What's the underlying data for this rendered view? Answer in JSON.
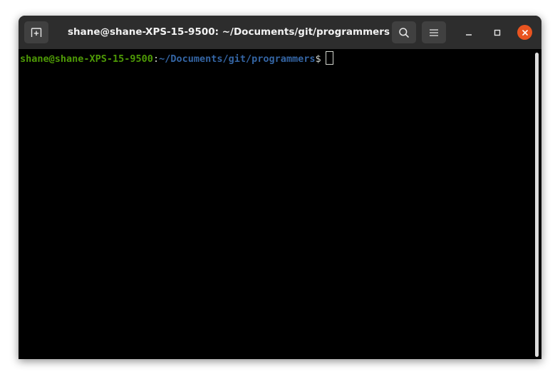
{
  "window": {
    "title": "shane@shane-XPS-15-9500: ~/Documents/git/programmers"
  },
  "titlebar": {
    "new_tab_icon": "new-tab-icon",
    "search_icon": "search-icon",
    "menu_icon": "hamburger-menu-icon",
    "minimize_icon": "minimize-icon",
    "maximize_icon": "maximize-icon",
    "close_icon": "close-icon"
  },
  "terminal": {
    "prompt_user": "shane@shane-XPS-15-9500",
    "prompt_colon": ":",
    "prompt_path": "~/Documents/git/programmers",
    "prompt_symbol": "$",
    "input": ""
  },
  "colors": {
    "titlebar_bg": "#2d2d2d",
    "terminal_bg": "#000000",
    "prompt_user": "#4e9a06",
    "prompt_path": "#3465a4",
    "close_button": "#e95420"
  }
}
